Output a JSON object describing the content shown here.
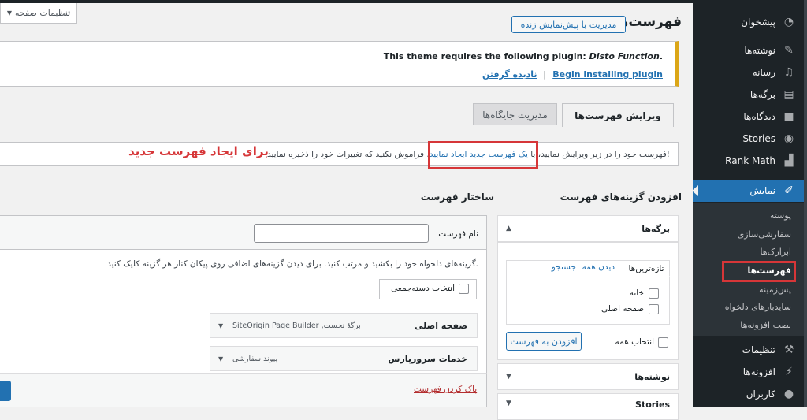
{
  "screen_options": "تنظیمات صفحه",
  "header": {
    "title": "فهرست‌ها",
    "live_manage_button": "مدیریت با پیش‌نمایش زنده"
  },
  "notice": {
    "text_prefix": "This theme requires the following plugin: ",
    "plugin_name": "Disto Function",
    "text_suffix": ".",
    "begin_link": "Begin installing plugin",
    "separator": "|",
    "dismiss_link": "نادیده گرفتن"
  },
  "tabs": {
    "edit_menus": "ویرایش فهرست‌ها",
    "manage_locations": "مدیریت جایگاه‌ها"
  },
  "info": {
    "before": "فهرست خود را در زیر ویرایش نمایید، یا ",
    "link": "یک فهرست جدید ایجاد نمایید",
    "after": ". فراموش نکنید که تغییرات خود را ذخیره نمایید!",
    "annotation": "برای ایجاد فهرست جدید"
  },
  "add_items": {
    "heading": "افزودن گزینه‌های فهرست",
    "pages_section": "برگه‌ها",
    "tab_recent": "تازه‌ترین‌ها",
    "tab_all": "دیدن همه",
    "tab_search": "جستجو",
    "items": [
      "خانه",
      "صفحه اصلی"
    ],
    "select_all": "انتخاب همه",
    "add_to_menu": "افزودن به فهرست",
    "posts_section": "نوشته‌ها",
    "stories_section": "Stories"
  },
  "structure": {
    "heading": "ساختار فهرست",
    "menu_name_label": "نام فهرست",
    "menu_name_value": "",
    "instructions": "گزینه‌های دلخواه خود را بکشید و مرتب کنید. برای دیدن گزینه‌های اضافی روی پیکان کنار هر گزینه کلیک کنید.",
    "bulk_select": "انتخاب دسته‌جمعی",
    "items": [
      {
        "title": "صفحه اصلی",
        "type": "SiteOrigin Page Builder ,برگهٔ نخست"
      },
      {
        "title": "خدمات سرورپارس",
        "type": "پیوند سفارشی"
      }
    ],
    "delete_menu": "پاک کردن فهرست"
  },
  "sidebar": {
    "items": [
      {
        "label": "پیشخوان",
        "icon": "dashboard-icon"
      },
      {
        "label": "نوشته‌ها",
        "icon": "pin-icon"
      },
      {
        "label": "رسانه",
        "icon": "media-icon"
      },
      {
        "label": "برگه‌ها",
        "icon": "page-icon"
      },
      {
        "label": "دیدگاه‌ها",
        "icon": "comment-icon"
      },
      {
        "label": "Stories",
        "icon": "stories-icon"
      },
      {
        "label": "Rank Math",
        "icon": "chart-icon"
      },
      {
        "label": "نمایش",
        "icon": "brush-icon"
      }
    ],
    "submenu": [
      "پوسته",
      "سفارشی‌سازی",
      "ابزارک‌ها",
      "فهرست‌ها",
      "پس‌زمینه",
      "ساید‌بارهای دلخواه",
      "نصب افزونه‌ها"
    ],
    "bottom_items": [
      {
        "label": "تنظیمات",
        "icon": "wrench-icon"
      },
      {
        "label": "افزونه‌ها",
        "icon": "plugin-icon"
      },
      {
        "label": "کاربران",
        "icon": "user-icon"
      }
    ]
  }
}
